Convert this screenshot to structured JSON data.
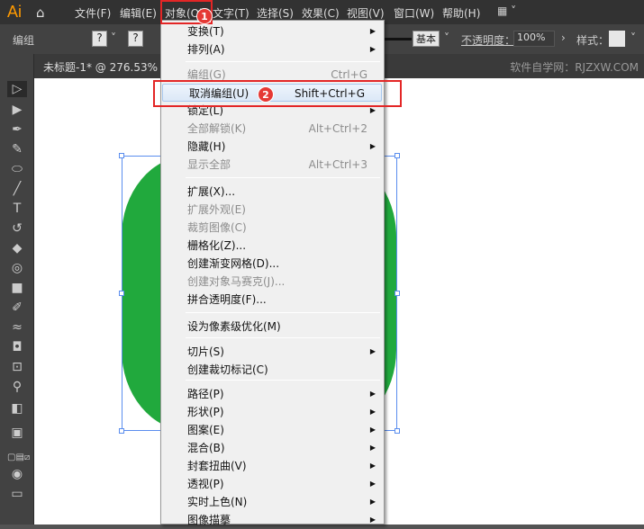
{
  "app": {
    "logo": "Ai"
  },
  "menubar": {
    "items": [
      "文件(F)",
      "编辑(E)",
      "对象(O)",
      "文字(T)",
      "选择(S)",
      "效果(C)",
      "视图(V)",
      "窗口(W)",
      "帮助(H)"
    ]
  },
  "control": {
    "group_label": "编组",
    "q1": "?",
    "q2": "?",
    "stroke_style": "基本",
    "opacity_label": "不透明度：",
    "opacity_value": "100%",
    "style_label": "样式："
  },
  "tab": {
    "title": "未标题-1* @ 276.53% (C",
    "watermark": "软件自学网：RJZXW.COM"
  },
  "colors": {
    "shape": "#21a93d",
    "selection": "#5a8dee",
    "highlight": "#e32626"
  },
  "menu": {
    "items": [
      {
        "label": "变换(T)",
        "submenu": true
      },
      {
        "label": "排列(A)",
        "submenu": true
      },
      {
        "label": "编组(G)",
        "shortcut": "Ctrl+G",
        "disabled": true
      },
      {
        "label": "取消编组(U)",
        "shortcut": "Shift+Ctrl+G",
        "highlighted": true
      },
      {
        "label": "锁定(L)",
        "submenu": true
      },
      {
        "label": "全部解锁(K)",
        "shortcut": "Alt+Ctrl+2",
        "disabled": true
      },
      {
        "label": "隐藏(H)",
        "submenu": true
      },
      {
        "label": "显示全部",
        "shortcut": "Alt+Ctrl+3",
        "disabled": true
      },
      {
        "label": "扩展(X)..."
      },
      {
        "label": "扩展外观(E)",
        "disabled": true
      },
      {
        "label": "裁剪图像(C)",
        "disabled": true
      },
      {
        "label": "栅格化(Z)..."
      },
      {
        "label": "创建渐变网格(D)..."
      },
      {
        "label": "创建对象马赛克(J)...",
        "disabled": true
      },
      {
        "label": "拼合透明度(F)..."
      },
      {
        "label": "设为像素级优化(M)"
      },
      {
        "label": "切片(S)",
        "submenu": true
      },
      {
        "label": "创建裁切标记(C)"
      },
      {
        "label": "路径(P)",
        "submenu": true
      },
      {
        "label": "形状(P)",
        "submenu": true
      },
      {
        "label": "图案(E)",
        "submenu": true
      },
      {
        "label": "混合(B)",
        "submenu": true
      },
      {
        "label": "封套扭曲(V)",
        "submenu": true
      },
      {
        "label": "透视(P)",
        "submenu": true
      },
      {
        "label": "实时上色(N)",
        "submenu": true
      },
      {
        "label": "图像描摹",
        "submenu": true
      }
    ]
  },
  "badges": [
    "1",
    "2"
  ]
}
